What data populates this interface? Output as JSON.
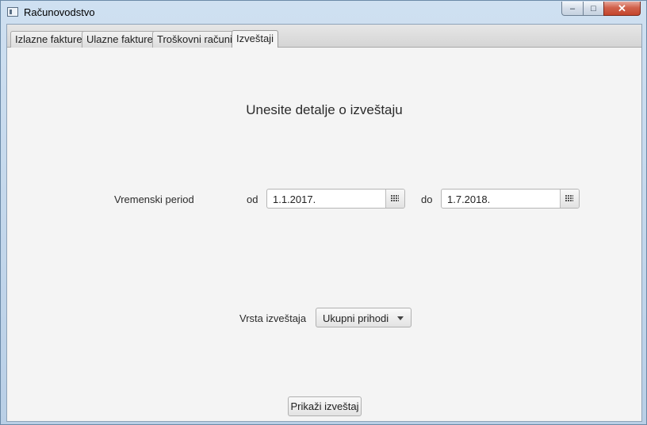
{
  "window": {
    "title": "Računovodstvo",
    "minimize": "‒",
    "maximize": "□",
    "close": "✕"
  },
  "tabs": [
    {
      "label": "Izlazne fakture"
    },
    {
      "label": "Ulazne fakture"
    },
    {
      "label": "Troškovni računi"
    },
    {
      "label": "Izveštaji",
      "active": true
    }
  ],
  "report": {
    "heading": "Unesite detalje o izveštaju",
    "period_label": "Vremenski period",
    "from_label": "od",
    "from_value": "1.1.2017.",
    "to_label": "do",
    "to_value": "1.7.2018.",
    "type_label": "Vrsta izveštaja",
    "type_value": "Ukupni prihodi",
    "show_button": "Prikaži izveštaj"
  }
}
